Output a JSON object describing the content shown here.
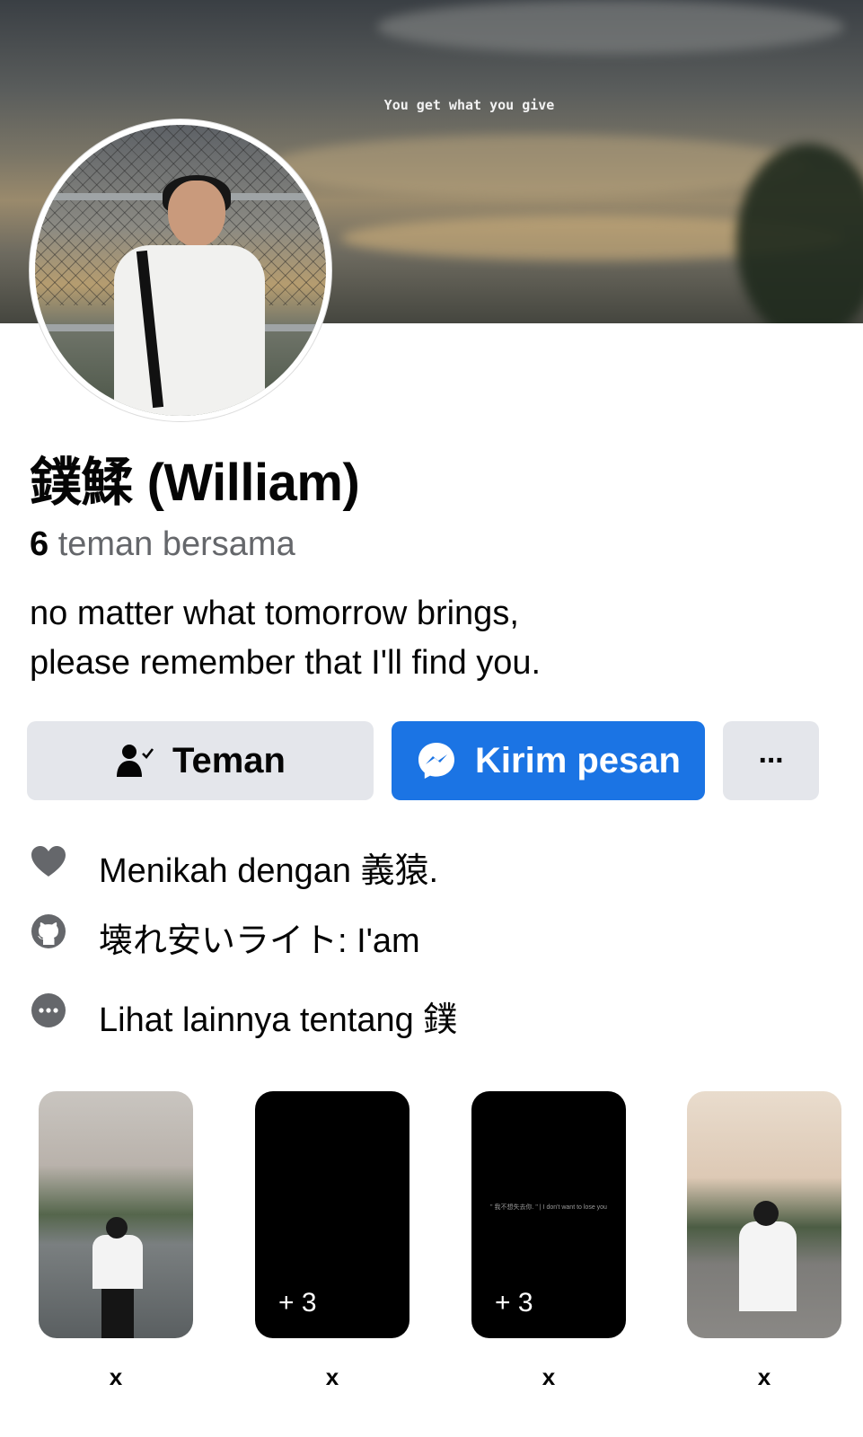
{
  "cover": {
    "quote": "You get what you give"
  },
  "profile": {
    "name": "鏷鰇 (William)",
    "mutual_count": "6",
    "mutual_label": "teman bersama",
    "bio_lines": [
      "no matter what tomorrow brings,",
      "please remember that I'll find you."
    ]
  },
  "actions": {
    "friend_label": "Teman",
    "message_label": "Kirim pesan",
    "more_label": "···"
  },
  "info": {
    "relationship": "Menikah dengan 義猿.",
    "github": "壊れ安いライト: I'am",
    "see_more": "Lihat lainnya tentang 鏷"
  },
  "stories": [
    {
      "label": "x",
      "count": ""
    },
    {
      "label": "x",
      "count": "+ 3",
      "caption": ""
    },
    {
      "label": "x",
      "count": "+ 3",
      "caption": "\" 我不想失去你. \" | I don't want to lose you"
    },
    {
      "label": "x",
      "count": ""
    }
  ],
  "colors": {
    "accent": "#1b74e4",
    "button_gray": "#e4e6eb",
    "secondary_text": "#65676b"
  }
}
